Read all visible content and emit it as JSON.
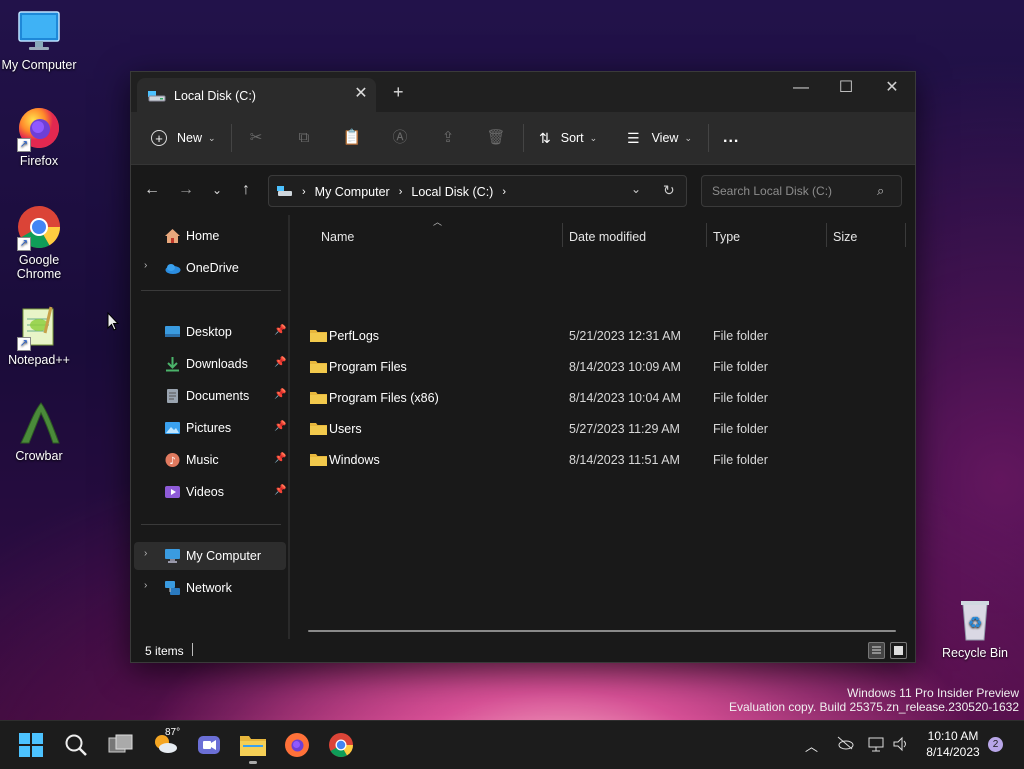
{
  "desktop": {
    "icons": [
      {
        "label": "My Computer"
      },
      {
        "label": "Firefox"
      },
      {
        "label": "Google Chrome"
      },
      {
        "label": "Notepad++"
      },
      {
        "label": "Crowbar"
      },
      {
        "label": "Recycle Bin"
      }
    ],
    "watermark": {
      "line1": "Windows 11 Pro Insider Preview",
      "line2": "Evaluation copy. Build 25375.zn_release.230520-1632"
    }
  },
  "window": {
    "tab_title": "Local Disk (C:)",
    "toolbar": {
      "new_label": "New",
      "sort_label": "Sort",
      "view_label": "View",
      "more_label": "..."
    },
    "address": {
      "crumbs": [
        "My Computer",
        "Local Disk (C:)"
      ]
    },
    "search": {
      "placeholder": "Search Local Disk (C:)"
    },
    "sidebar": {
      "home": "Home",
      "onedrive": "OneDrive",
      "quick": [
        {
          "label": "Desktop",
          "icon": "desktop-icon"
        },
        {
          "label": "Downloads",
          "icon": "downloads-icon"
        },
        {
          "label": "Documents",
          "icon": "documents-icon"
        },
        {
          "label": "Pictures",
          "icon": "pictures-icon"
        },
        {
          "label": "Music",
          "icon": "music-icon"
        },
        {
          "label": "Videos",
          "icon": "videos-icon"
        }
      ],
      "my_computer": "My Computer",
      "network": "Network"
    },
    "columns": {
      "name": "Name",
      "date": "Date modified",
      "type": "Type",
      "size": "Size"
    },
    "files": [
      {
        "name": "PerfLogs",
        "date": "5/21/2023 12:31 AM",
        "type": "File folder"
      },
      {
        "name": "Program Files",
        "date": "8/14/2023 10:09 AM",
        "type": "File folder"
      },
      {
        "name": "Program Files (x86)",
        "date": "8/14/2023 10:04 AM",
        "type": "File folder"
      },
      {
        "name": "Users",
        "date": "5/27/2023 11:29 AM",
        "type": "File folder"
      },
      {
        "name": "Windows",
        "date": "8/14/2023 11:51 AM",
        "type": "File folder"
      }
    ],
    "status": {
      "items": "5 items"
    }
  },
  "taskbar": {
    "weather_temp": "87°",
    "time": "10:10 AM",
    "date": "8/14/2023",
    "notifications": "2"
  },
  "colors": {
    "folder": "#f2c94c",
    "accent": "#4cc2ff"
  }
}
